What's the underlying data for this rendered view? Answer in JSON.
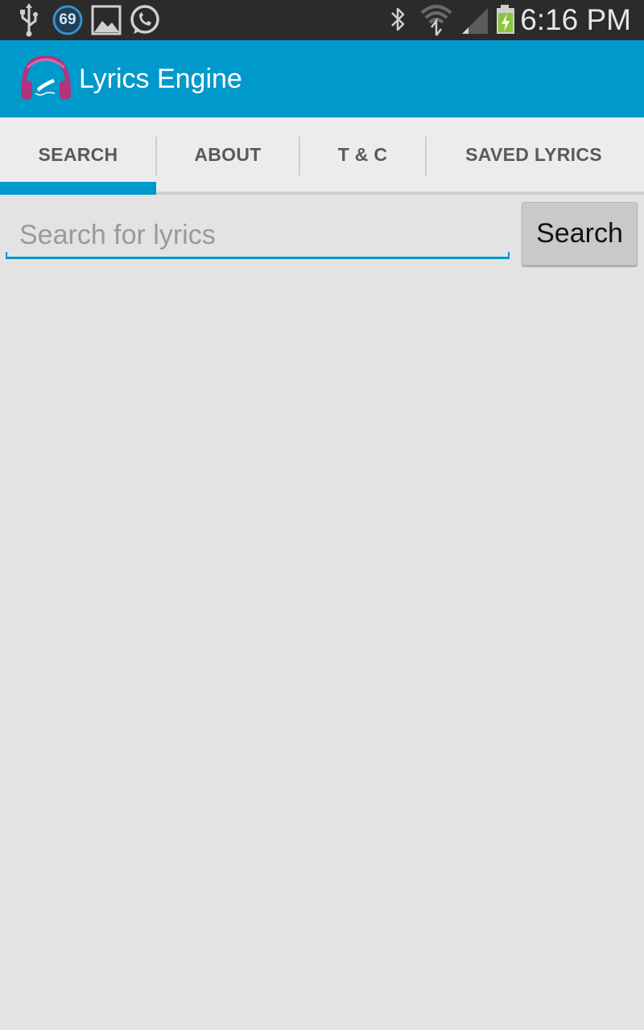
{
  "status_bar": {
    "time": "6:16 PM",
    "notification_badge": "69",
    "left_icons": [
      "usb-icon",
      "badge-icon",
      "gallery-icon",
      "whatsapp-icon"
    ],
    "right_icons": [
      "bluetooth-icon",
      "wifi-icon",
      "signal-icon",
      "battery-charging-icon"
    ],
    "colors": {
      "background": "#2b2b2b",
      "battery_green": "#8cc63f"
    }
  },
  "app_bar": {
    "title": "Lyrics Engine",
    "logo": "headphones-pen-logo",
    "colors": {
      "background": "#0099cc",
      "logo": "#b0357d"
    }
  },
  "tabs": [
    {
      "label": "SEARCH",
      "selected": true
    },
    {
      "label": "ABOUT",
      "selected": false
    },
    {
      "label": "T & C",
      "selected": false
    },
    {
      "label": "SAVED LYRICS",
      "selected": false
    }
  ],
  "search": {
    "placeholder": "Search for lyrics",
    "value": "",
    "button_label": "Search"
  },
  "colors": {
    "accent": "#0099cc",
    "page_background": "#e3e3e3"
  }
}
